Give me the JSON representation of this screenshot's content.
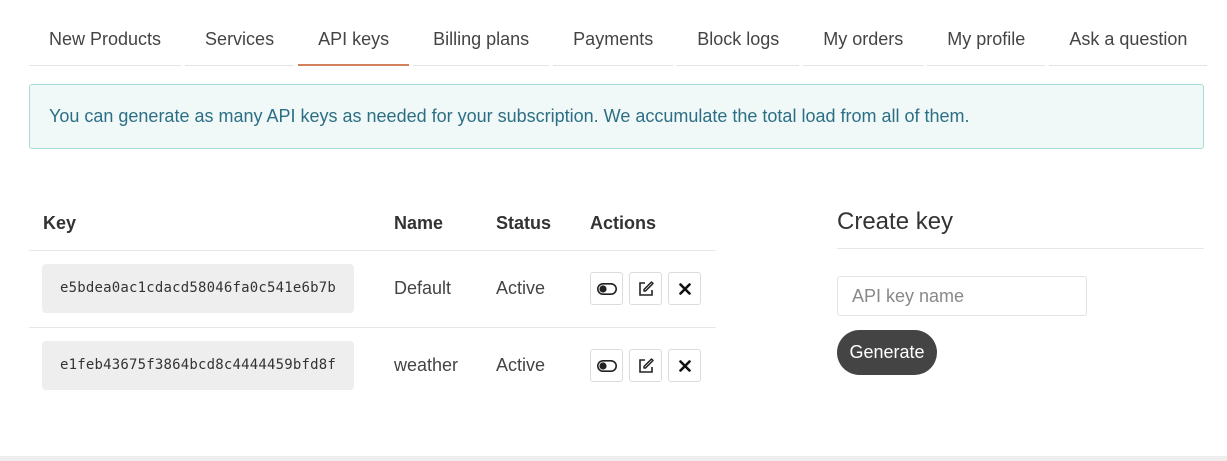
{
  "tabs": [
    {
      "label": "New Products"
    },
    {
      "label": "Services"
    },
    {
      "label": "API keys",
      "active": true
    },
    {
      "label": "Billing plans"
    },
    {
      "label": "Payments"
    },
    {
      "label": "Block logs"
    },
    {
      "label": "My orders"
    },
    {
      "label": "My profile"
    },
    {
      "label": "Ask a question"
    }
  ],
  "alert": {
    "text": "You can generate as many API keys as needed for your subscription. We accumulate the total load from all of them."
  },
  "table": {
    "headers": {
      "key": "Key",
      "name": "Name",
      "status": "Status",
      "actions": "Actions"
    },
    "rows": [
      {
        "key": "e5bdea0ac1cdacd58046fa0c541e6b7b",
        "name": "Default",
        "status": "Active"
      },
      {
        "key": "e1feb43675f3864bcd8c4444459bfd8f",
        "name": "weather",
        "status": "Active"
      }
    ],
    "action_icons": [
      "toggle-icon",
      "edit-icon",
      "delete-icon"
    ]
  },
  "create_key": {
    "title": "Create key",
    "input_placeholder": "API key name",
    "input_value": "",
    "button_label": "Generate"
  },
  "colors": {
    "active_tab_underline": "#d2825a",
    "alert_bg": "#f1f9f8",
    "alert_border": "#a8dcd6",
    "alert_text": "#2c6f85",
    "generate_button_bg": "#444444"
  }
}
